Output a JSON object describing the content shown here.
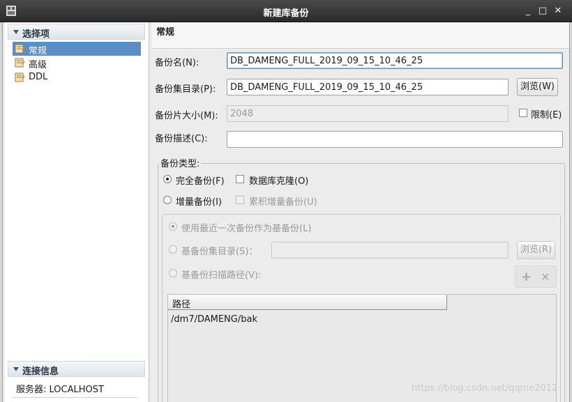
{
  "window": {
    "title": "新建库备份",
    "minimize": "_",
    "maximize": "□",
    "close": "✕"
  },
  "sidebar": {
    "options_header": "选择项",
    "items": [
      {
        "label": "常规",
        "selected": true
      },
      {
        "label": "高级",
        "selected": false
      },
      {
        "label": "DDL",
        "selected": false
      }
    ],
    "connection_header": "连接信息",
    "server_label": "服务器: LOCALHOST"
  },
  "form": {
    "section_title": "常规",
    "backup_name_label": "备份名(N):",
    "backup_name_value": "DB_DAMENG_FULL_2019_09_15_10_46_25",
    "backup_dir_label": "备份集目录(P):",
    "backup_dir_value": "DB_DAMENG_FULL_2019_09_15_10_46_25",
    "browse_label": "浏览(W)",
    "piece_size_label": "备份片大小(M):",
    "piece_size_value": "2048",
    "limit_label": "限制(E)",
    "desc_label": "备份描述(C):",
    "desc_value": "",
    "backup_type_title": "备份类型:",
    "full_backup_label": "完全备份(F)",
    "db_clone_label": "数据库克隆(O)",
    "incremental_label": "增量备份(I)",
    "cumulative_label": "累积增量备份(U)",
    "use_latest_label": "使用最近一次备份作为基备份(L)",
    "base_dir_label": "基备份集目录(S)：",
    "base_dir_value": "",
    "browse2_label": "浏览(R)",
    "scan_path_label": "基备份扫描路径(V):",
    "add_icon": "+",
    "remove_icon": "✕",
    "path_header": "路径",
    "paths": [
      "/dm7/DAMENG/bak"
    ]
  },
  "watermark": "https://blog.csdn.net/qqme2012"
}
